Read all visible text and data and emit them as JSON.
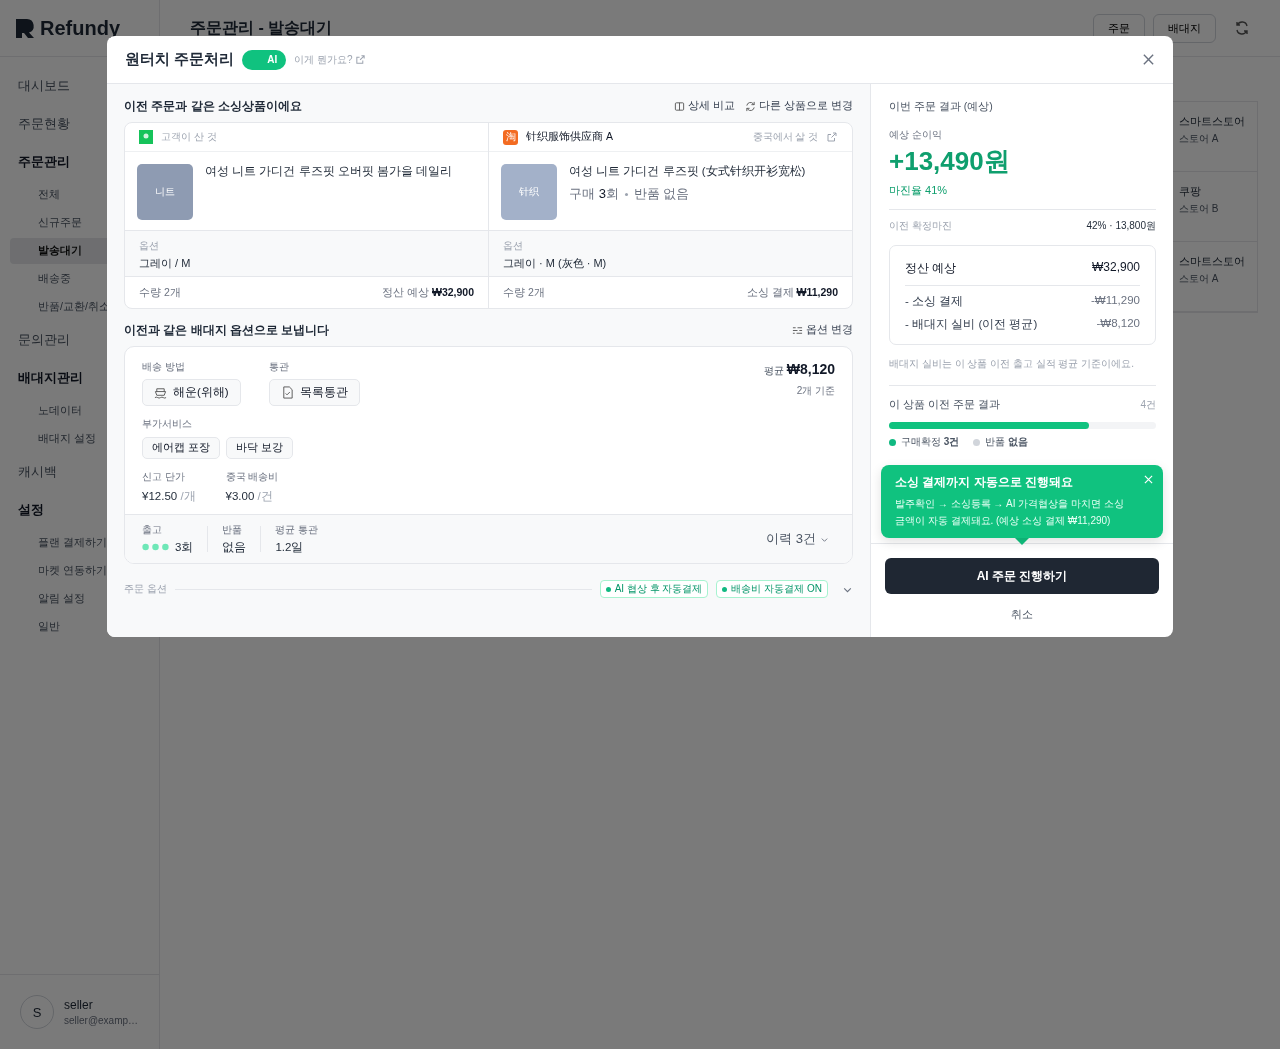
{
  "sidebar": {
    "logo": "Refundy",
    "items": [
      {
        "label": "대시보드",
        "selected": false
      },
      {
        "label": "주문현황",
        "selected": false
      },
      {
        "label": "주문관리",
        "selected": false,
        "children": [
          {
            "label": "전체",
            "selected": false
          },
          {
            "label": "신규주문",
            "selected": false
          },
          {
            "label": "발송대기",
            "selected": true
          },
          {
            "label": "배송중",
            "selected": false
          },
          {
            "label": "반품/교환/취소",
            "selected": false
          }
        ]
      },
      {
        "label": "문의관리",
        "selected": false
      },
      {
        "label": "배대지관리",
        "selected": false,
        "children": [
          {
            "label": "노데이터",
            "selected": false
          },
          {
            "label": "배대지 설정",
            "selected": false
          }
        ]
      },
      {
        "label": "캐시백",
        "selected": false
      },
      {
        "label": "설정",
        "selected": false,
        "children": [
          {
            "label": "플랜 결제하기",
            "selected": false
          },
          {
            "label": "마켓 연동하기",
            "selected": false
          },
          {
            "label": "알림 설정",
            "selected": false
          },
          {
            "label": "일반",
            "selected": false
          }
        ]
      }
    ],
    "user": {
      "avatar": "S",
      "name": "seller",
      "email": "seller@examp…"
    }
  },
  "page": {
    "title": "주문관리 - 발송대기",
    "buttons": [
      "주문",
      "배대지"
    ],
    "rows": [
      {
        "market": "스마트스토어",
        "store": "스토어 A"
      },
      {
        "market": "쿠팡",
        "store": "스토어 B"
      },
      {
        "market": "스마트스토어",
        "store": "스토어 A"
      }
    ]
  },
  "modal": {
    "title": "원터치 주문처리",
    "ai_toggle": {
      "label": "AI",
      "on": true
    },
    "help_link": "이게 뭔가요?",
    "sourcing": {
      "title": "이전 주문과 같은 소싱상품이에요",
      "actions": [
        "상세 비교",
        "다른 상품으로 변경"
      ],
      "columns": [
        {
          "kind": "customer",
          "header": "고객이 산 것",
          "thumb": "니트",
          "name": "여성 니트 가디건 루즈핏 오버핏 봄가을 데일리",
          "option_label": "옵션",
          "option": "그레이 / M",
          "qty": "수량 2개",
          "amount_label": "정산 예상",
          "amount": "₩32,900"
        },
        {
          "kind": "source",
          "badge": "淘",
          "header": "针织服饰供应商 A",
          "header_note": "중국에서 살 것",
          "thumb": "针织",
          "name": "여성 니트 가디건 루즈핏 (女式针织开衫宽松)",
          "meta": [
            "구매 **3**회",
            "반품 없음"
          ],
          "option_label": "옵션",
          "option": "그레이 · M (灰色 · M)",
          "qty": "수량 2개",
          "amount_label": "소싱 결제",
          "amount": "₩11,290"
        }
      ]
    },
    "shipping": {
      "title": "이전과 같은 배대지 옵션으로 보냅니다",
      "action": "옵션 변경",
      "method_label": "배송 방법",
      "method": "해운(위해)",
      "customs_label": "통관",
      "customs": "목록통관",
      "extras_label": "부가서비스",
      "extras": [
        "에어캡 포장",
        "바닥 보강"
      ],
      "fees": [
        {
          "label": "신고 단가",
          "value": "¥12.50",
          "unit": "/개"
        },
        {
          "label": "중국 배송비",
          "value": "¥3.00",
          "unit": "/건"
        }
      ],
      "avg_label": "평균",
      "avg": "₩8,120",
      "avg_note": "2개 기준",
      "stats": [
        {
          "kind": "dots",
          "label": "출고",
          "value": "3회"
        },
        {
          "kind": "plain",
          "label": "반품",
          "value": "없음"
        },
        {
          "kind": "plain",
          "label": "평균 통관",
          "value": "1.2일"
        }
      ],
      "history": "이력 3건"
    },
    "order_options": {
      "label": "주문 옵션",
      "tags": [
        "AI 협상 후 자동결제",
        "배송비 자동결제 ON"
      ]
    },
    "result": {
      "title": "이번 주문 결과 (예상)",
      "profit_label": "예상 순이익",
      "profit": "+13,490원",
      "margin": "마진율 41%",
      "prev_label": "이전 확정마진",
      "prev": "42% · 13,800원",
      "breakdown": [
        {
          "kind": "total",
          "label": "정산 예상",
          "value": "₩32,900"
        },
        {
          "kind": "deduct",
          "label": "- 소싱 결제",
          "value": "-₩11,290"
        },
        {
          "kind": "deduct",
          "label": "- 배대지 실비 (이전 평균)",
          "value": "-₩8,120"
        }
      ],
      "note": "배대지 실비는 이 상품 이전 출고 실적 평균 기준이에요.",
      "history_title": "이 상품 이전 주문 결과",
      "history_count": "4건",
      "level": 0.75,
      "legend": [
        {
          "label": "구매확정",
          "value": "3건",
          "color": "#10b981"
        },
        {
          "label": "반품",
          "value": "없음",
          "color": "#d1d5db"
        }
      ],
      "tooltip": {
        "title": "소싱 결제까지 자동으로 진행돼요",
        "body": "발주확인 → 소싱등록 → AI 가격협상을 마치면 소싱 금액이 자동 결제돼요. (예상 소싱 결제 ₩11,290)"
      },
      "primary": "AI 주문 진행하기",
      "cancel": "취소"
    }
  }
}
